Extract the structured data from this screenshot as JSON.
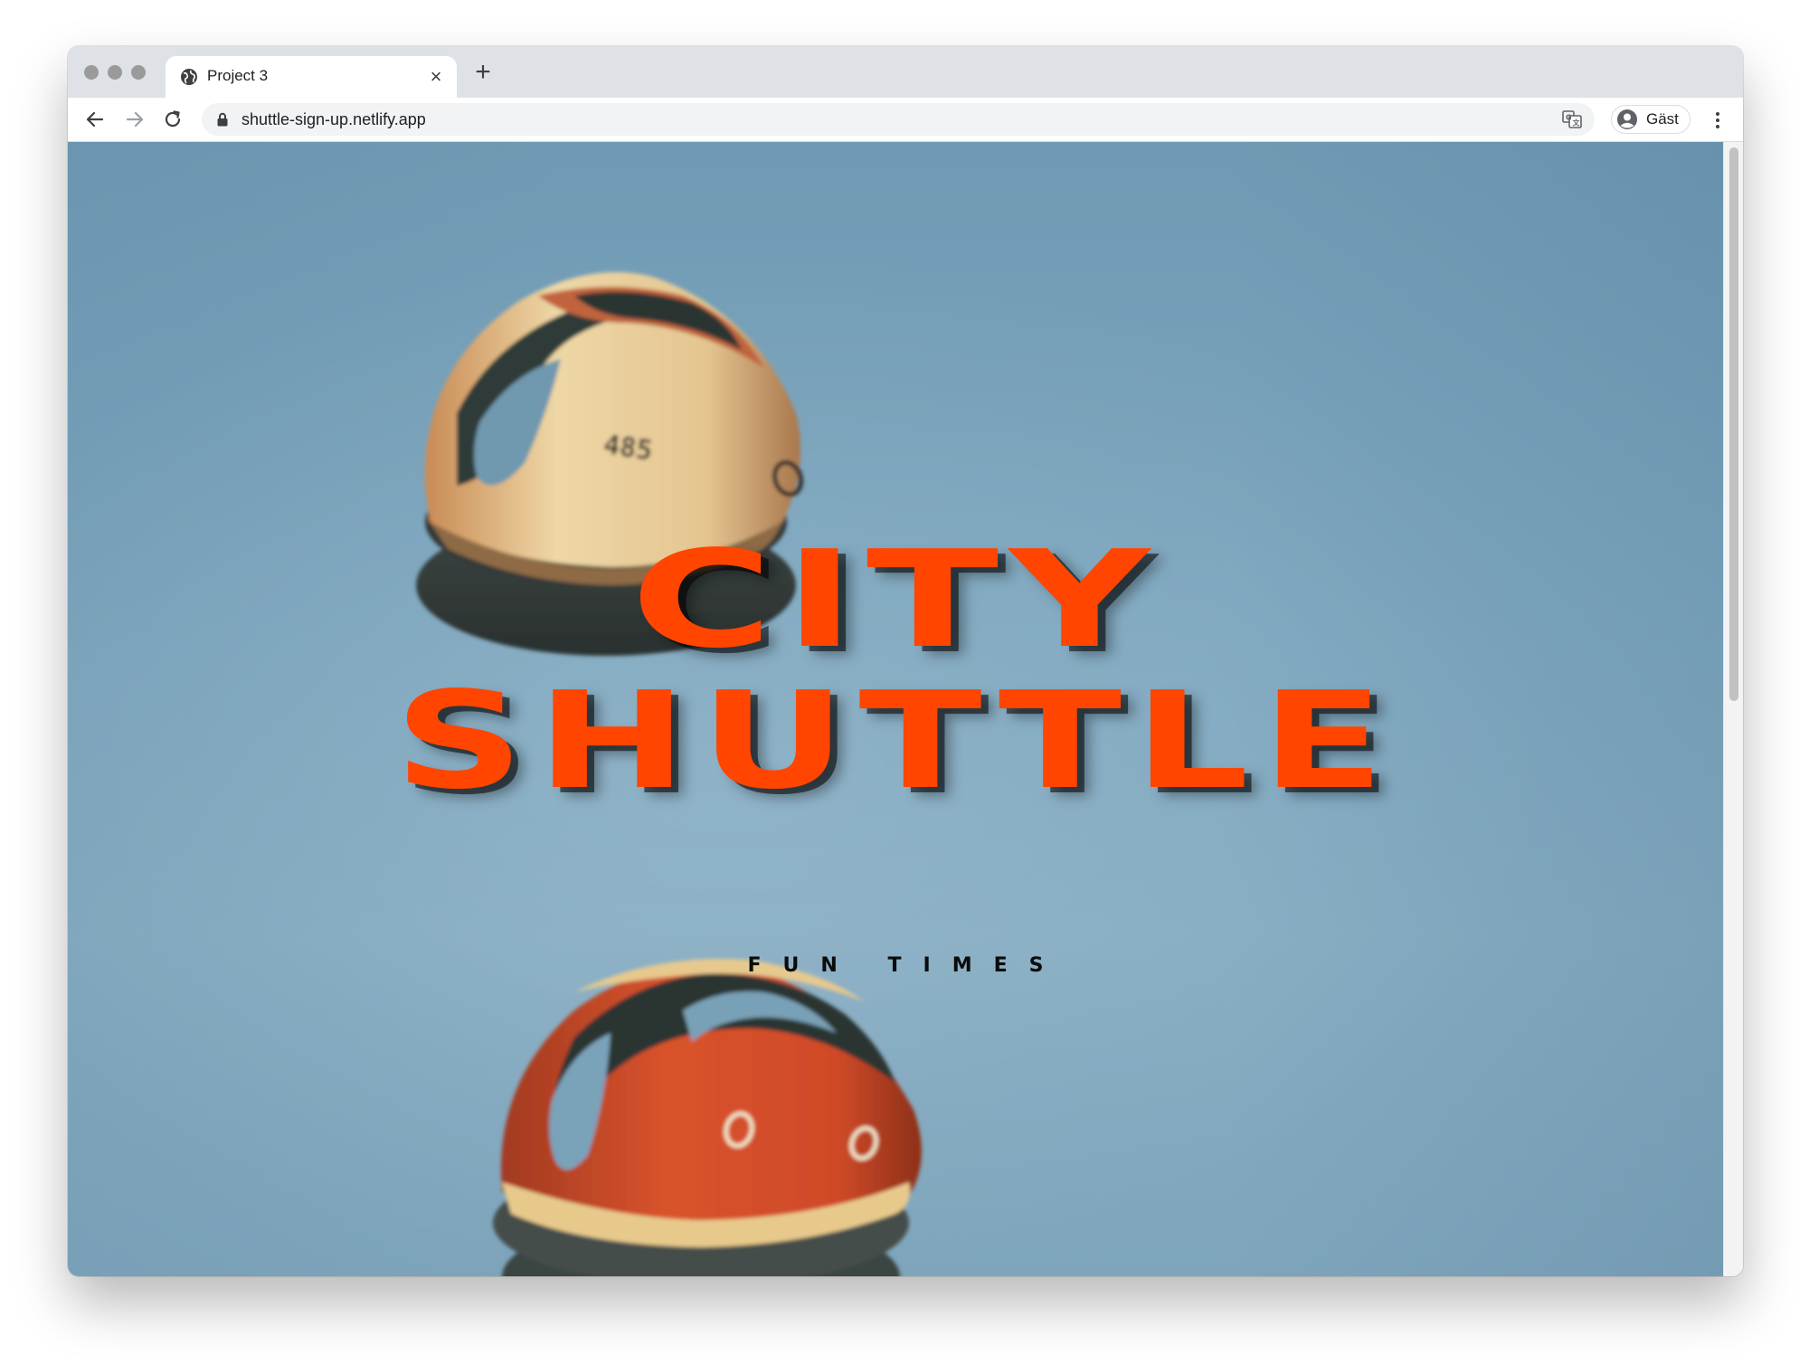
{
  "browser": {
    "tab": {
      "title": "Project 3",
      "favicon": "globe-icon",
      "close_icon": "close-icon"
    },
    "new_tab_icon": "plus-icon",
    "toolbar": {
      "back_icon": "arrow-left-icon",
      "forward_icon": "arrow-right-icon",
      "reload_icon": "reload-icon",
      "lock_icon": "lock-icon",
      "url": "shuttle-sign-up.netlify.app",
      "translate_icon": "translate-icon",
      "profile_label": "Gäst",
      "profile_icon": "avatar-icon",
      "menu_icon": "kebab-menu-icon"
    }
  },
  "page": {
    "title_line1": "CITY",
    "title_line2": "SHUTTLE",
    "tagline": "FUN TIMES",
    "colors": {
      "title": "#ff4500",
      "tagline": "#0b0b0b",
      "sky": "#7ea7bf"
    }
  }
}
